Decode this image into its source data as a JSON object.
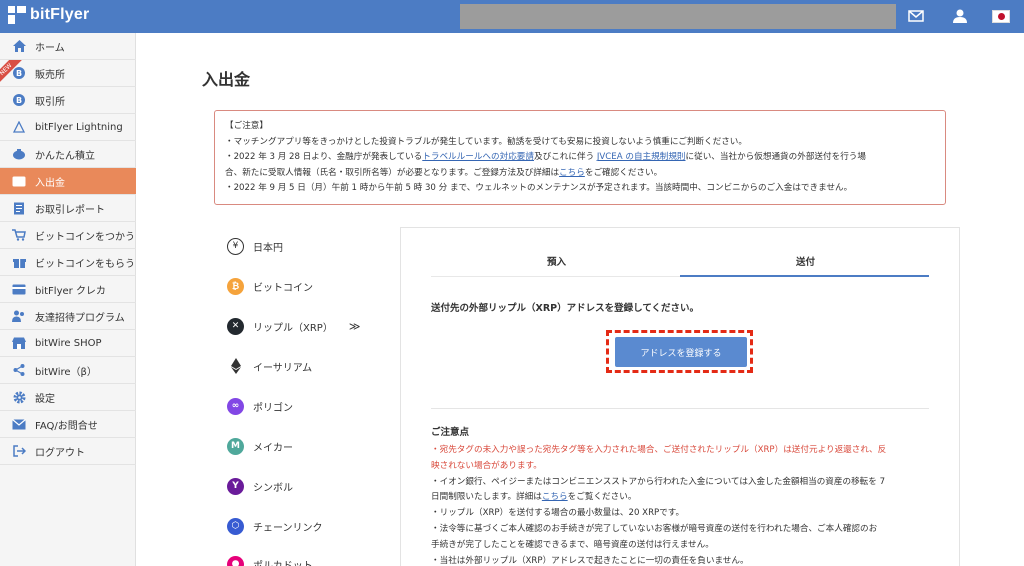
{
  "app": {
    "logo_text": "bitFlyer"
  },
  "sidebar": {
    "items": [
      {
        "label": "ホーム",
        "icon": "home-icon"
      },
      {
        "label": "販売所",
        "icon": "bitcoin-coin-icon",
        "badge": "NEW"
      },
      {
        "label": "取引所",
        "icon": "bitcoin-coin-icon"
      },
      {
        "label": "bitFlyer Lightning",
        "icon": "lightning-icon"
      },
      {
        "label": "かんたん積立",
        "icon": "piggy-bank-icon"
      },
      {
        "label": "入出金",
        "icon": "wallet-icon",
        "active": true
      },
      {
        "label": "お取引レポート",
        "icon": "report-icon"
      },
      {
        "label": "ビットコインをつかう",
        "icon": "cart-icon"
      },
      {
        "label": "ビットコインをもらう",
        "icon": "gift-icon"
      },
      {
        "label": "bitFlyer クレカ",
        "icon": "credit-card-icon"
      },
      {
        "label": "友達招待プログラム",
        "icon": "friends-icon"
      },
      {
        "label": "bitWire SHOP",
        "icon": "shop-icon"
      },
      {
        "label": "bitWire（β）",
        "icon": "share-icon"
      },
      {
        "label": "設定",
        "icon": "gear-icon"
      },
      {
        "label": "FAQ/お問合せ",
        "icon": "mail-icon"
      },
      {
        "label": "ログアウト",
        "icon": "logout-icon"
      }
    ]
  },
  "page": {
    "title": "入出金"
  },
  "notice": {
    "heading": "【ご注意】",
    "line1": "・マッチングアプリ等をきっかけとした投資トラブルが発生しています。勧誘を受けても安易に投資しないよう慎重にご判断ください。",
    "line2_a": "・2022 年 3 月 28 日より、金融庁が発表している",
    "line2_link1": "トラベルルールへの対応要請",
    "line2_b": "及びこれに伴う ",
    "line2_link2": "JVCEA の自主規制規則",
    "line2_c": "に従い、当社から仮想通貨の外部送付を行う場",
    "line3_a": "合、新たに受取人情報（氏名・取引所名等）が必要となります。ご登録方法及び詳細は",
    "line3_link": "こちら",
    "line3_b": "をご確認ください。",
    "line4": "・2022 年 9 月 5 日（月）午前 1 時から午前 5 時 30 分 まで、ウェルネットのメンテナンスが予定されます。当該時間中、コンビニからのご入金はできません。"
  },
  "currencies": [
    {
      "label": "日本円",
      "icon": "yen-icon"
    },
    {
      "label": "ビットコイン",
      "icon": "bitcoin-icon"
    },
    {
      "label": "リップル（XRP）",
      "icon": "xrp-icon",
      "selected": true,
      "arrow": "≫"
    },
    {
      "label": "イーサリアム",
      "icon": "ethereum-icon"
    },
    {
      "label": "ポリゴン",
      "icon": "polygon-icon"
    },
    {
      "label": "メイカー",
      "icon": "maker-icon"
    },
    {
      "label": "シンボル",
      "icon": "symbol-icon"
    },
    {
      "label": "チェーンリンク",
      "icon": "chainlink-icon"
    },
    {
      "label": "ポルカドット",
      "icon": "polkadot-icon"
    }
  ],
  "panel": {
    "tabs": {
      "deposit": "預入",
      "send": "送付",
      "active": "send"
    },
    "instruction": "送付先の外部リップル（XRP）アドレスを登録してください。",
    "register_button": "アドレスを登録する",
    "caution_title": "ご注意点",
    "caution_red_1": "・宛先タグの未入力や誤った宛先タグ等を入力された場合、ご送付されたリップル（XRP）は送付元より返還され、反",
    "caution_red_2": "映されない場合があります。",
    "caution_2_1": "・イオン銀行、ペイジーまたはコンビニエンスストアから行われた入金については入金した金額相当の資産の移転を 7",
    "caution_2_2a": "日間制限いたします。詳細は",
    "caution_2_link": "こちら",
    "caution_2_2b": "をご覧ください。",
    "caution_3": "・リップル（XRP）を送付する場合の最小数量は、20 XRPです。",
    "caution_4_1": "・法令等に基づくご本人確認のお手続きが完了していないお客様が暗号資産の送付を行われた場合、ご本人確認のお",
    "caution_4_2": "手続きが完了したことを確認できるまで、暗号資産の送付は行えません。",
    "caution_5": "・当社は外部リップル（XRP）アドレスで起きたことに一切の責任を負いません。"
  },
  "colors": {
    "header": "#4c7cc4",
    "sidebar_active": "#e9895a",
    "notice_border": "#d98a80",
    "button": "#5a8ad0",
    "highlight_frame": "#e42a15",
    "warning_text": "#d94a3c"
  }
}
